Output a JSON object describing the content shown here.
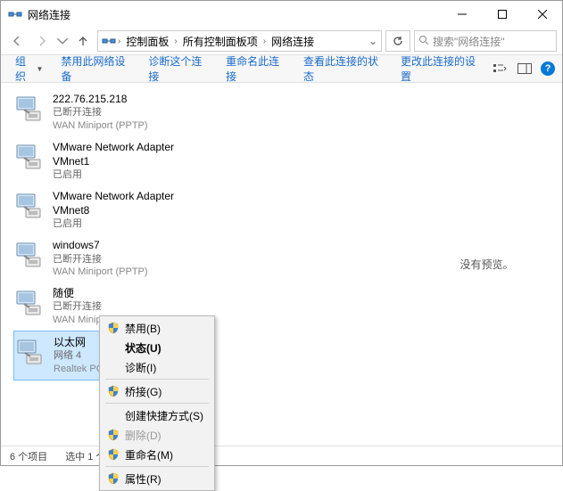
{
  "window": {
    "title": "网络连接"
  },
  "breadcrumb": {
    "items": [
      "控制面板",
      "所有控制面板项",
      "网络连接"
    ]
  },
  "search": {
    "placeholder": "搜索\"网络连接\""
  },
  "toolbar": {
    "organize": "组织",
    "items": [
      "禁用此网络设备",
      "诊断这个连接",
      "重命名此连接",
      "查看此连接的状态",
      "更改此连接的设置"
    ]
  },
  "connections": [
    {
      "name": "222.76.215.218",
      "status": "已断开连接",
      "device": "WAN Miniport (PPTP)"
    },
    {
      "name": "VMware Network Adapter VMnet1",
      "status": "已启用",
      "device": ""
    },
    {
      "name": "VMware Network Adapter VMnet8",
      "status": "已启用",
      "device": ""
    },
    {
      "name": "windows7",
      "status": "已断开连接",
      "device": "WAN Miniport (PPTP)"
    },
    {
      "name": "随便",
      "status": "已断开连接",
      "device": "WAN Miniport (PPTP)"
    },
    {
      "name": "以太网",
      "status": "网络 4",
      "device": "Realtek PCI"
    }
  ],
  "preview": {
    "text": "没有预览。"
  },
  "context_menu": {
    "items": [
      {
        "label": "禁用(B)",
        "shield": true,
        "enabled": true
      },
      {
        "label": "状态(U)",
        "shield": false,
        "enabled": true,
        "bold": true
      },
      {
        "label": "诊断(I)",
        "shield": false,
        "enabled": true
      },
      {
        "sep": true
      },
      {
        "label": "桥接(G)",
        "shield": true,
        "enabled": true
      },
      {
        "sep": true
      },
      {
        "label": "创建快捷方式(S)",
        "shield": false,
        "enabled": true
      },
      {
        "label": "删除(D)",
        "shield": true,
        "enabled": false
      },
      {
        "label": "重命名(M)",
        "shield": true,
        "enabled": true
      },
      {
        "sep": true
      },
      {
        "label": "属性(R)",
        "shield": true,
        "enabled": true
      }
    ]
  },
  "statusbar": {
    "count": "6 个项目",
    "selected": "选中 1 个项"
  }
}
